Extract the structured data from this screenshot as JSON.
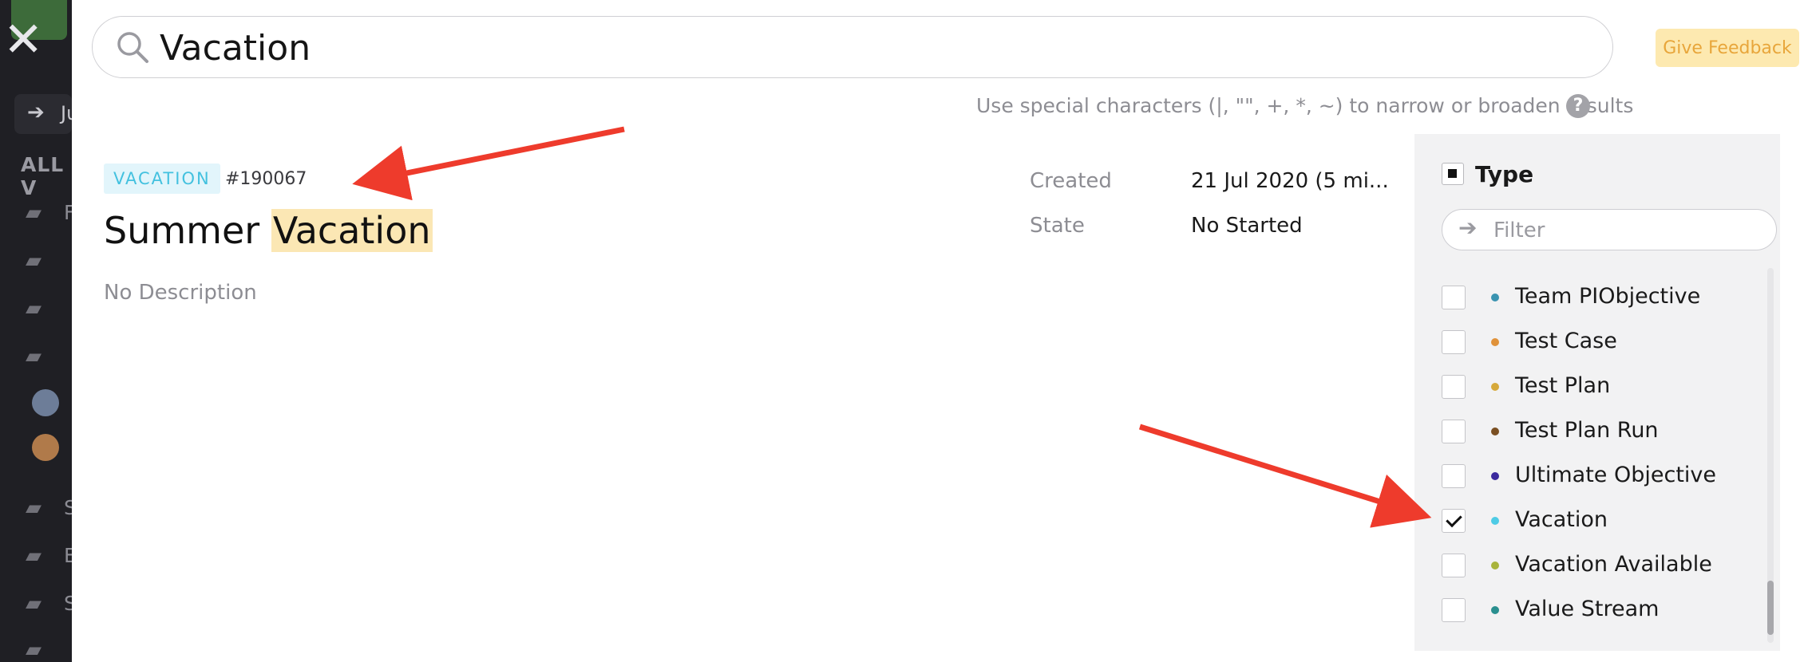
{
  "backdrop": {
    "jump_label": "Ju",
    "all_label": "ALL V",
    "item_initials": [
      "F",
      "S",
      "E",
      "S"
    ]
  },
  "search": {
    "value": "Vacation",
    "placeholder": "Search",
    "hint": "Use special characters (|, \"\", +, *, ~) to narrow or broaden results",
    "help_label": "?"
  },
  "feedback_label": "Give Feedback",
  "result": {
    "type_badge": "VACATION",
    "id": "#190067",
    "title_prefix": "Summer ",
    "title_highlight": "Vacation",
    "description": "No Description",
    "created_label": "Created",
    "created_value": "21 Jul 2020 (5 mi...",
    "state_label": "State",
    "state_value": "No Started",
    "badge_color": "#43c1df"
  },
  "filter": {
    "heading": "Type",
    "filter_placeholder": "Filter",
    "options": [
      {
        "label": "Team PIObjective",
        "color": "#3a93b0",
        "checked": false
      },
      {
        "label": "Test Case",
        "color": "#e0923a",
        "checked": false
      },
      {
        "label": "Test Plan",
        "color": "#d6a93a",
        "checked": false
      },
      {
        "label": "Test Plan Run",
        "color": "#7a4f22",
        "checked": false
      },
      {
        "label": "Ultimate Objective",
        "color": "#3b2a9e",
        "checked": false
      },
      {
        "label": "Vacation",
        "color": "#4ecbe5",
        "checked": true
      },
      {
        "label": "Vacation Available",
        "color": "#a9b43c",
        "checked": false
      },
      {
        "label": "Value Stream",
        "color": "#2a8f8f",
        "checked": false
      }
    ]
  },
  "annotation_color": "#ee3b2c"
}
